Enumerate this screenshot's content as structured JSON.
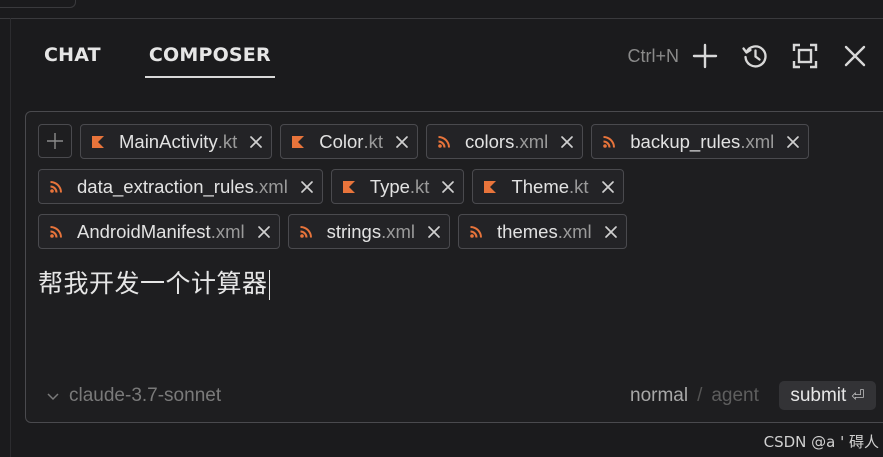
{
  "tabs": [
    {
      "label": "CHAT",
      "active": false
    },
    {
      "label": "COMPOSER",
      "active": true
    }
  ],
  "toolbar": {
    "shortcut": "Ctrl+N",
    "icons": [
      "plus-icon",
      "history-icon",
      "maximize-icon",
      "close-icon"
    ]
  },
  "context_files": [
    {
      "name": "MainActivity",
      "ext": ".kt",
      "type": "kotlin"
    },
    {
      "name": "Color",
      "ext": ".kt",
      "type": "kotlin"
    },
    {
      "name": "colors",
      "ext": ".xml",
      "type": "xml"
    },
    {
      "name": "backup_rules",
      "ext": ".xml",
      "type": "xml"
    },
    {
      "name": "data_extraction_rules",
      "ext": ".xml",
      "type": "xml"
    },
    {
      "name": "Type",
      "ext": ".kt",
      "type": "kotlin"
    },
    {
      "name": "Theme",
      "ext": ".kt",
      "type": "kotlin"
    },
    {
      "name": "AndroidManifest",
      "ext": ".xml",
      "type": "xml"
    },
    {
      "name": "strings",
      "ext": ".xml",
      "type": "xml"
    },
    {
      "name": "themes",
      "ext": ".xml",
      "type": "xml"
    }
  ],
  "prompt_text": "帮我开发一个计算器",
  "model": "claude-3.7-sonnet",
  "modes": {
    "normal": "normal",
    "separator": "/",
    "agent": "agent"
  },
  "submit": {
    "label": "submit",
    "enter_glyph": "⏎"
  },
  "watermark": "CSDN @a '    碍人",
  "colors": {
    "kotlin_icon": "#e8743b",
    "xml_icon": "#e8743b",
    "background": "#1b1b1d",
    "border": "#4a4a4e"
  }
}
